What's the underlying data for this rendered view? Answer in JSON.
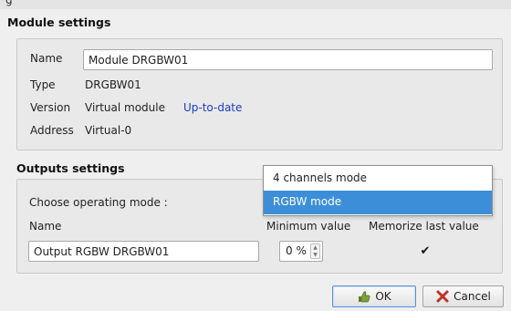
{
  "window": {
    "title_fragment": "g"
  },
  "module_settings": {
    "title": "Module settings",
    "name_label": "Name",
    "name_value": "Module DRGBW01",
    "type_label": "Type",
    "type_value": "DRGBW01",
    "version_label": "Version",
    "version_value": "Virtual module",
    "version_status": "Up-to-date",
    "address_label": "Address",
    "address_value": "Virtual-0"
  },
  "outputs_settings": {
    "title": "Outputs settings",
    "mode_label": "Choose operating mode :",
    "mode_options": [
      "4 channels mode",
      "RGBW mode"
    ],
    "mode_selected": "RGBW mode",
    "col_name": "Name",
    "col_min": "Minimum value",
    "col_memorize": "Memorize last value",
    "output": {
      "name": "Output RGBW DRGBW01",
      "min_value": "0 %",
      "memorize_checked": true,
      "check_glyph": "✔"
    }
  },
  "buttons": {
    "ok_label": "OK",
    "cancel_label": "Cancel",
    "ok_icon": "thumbs-up-icon",
    "cancel_icon": "x-icon"
  },
  "colors": {
    "selection": "#3d8ed8",
    "link": "#1a3cc8",
    "cancel_x": "#c0302a",
    "ok_hand": "#5b7f2a"
  }
}
